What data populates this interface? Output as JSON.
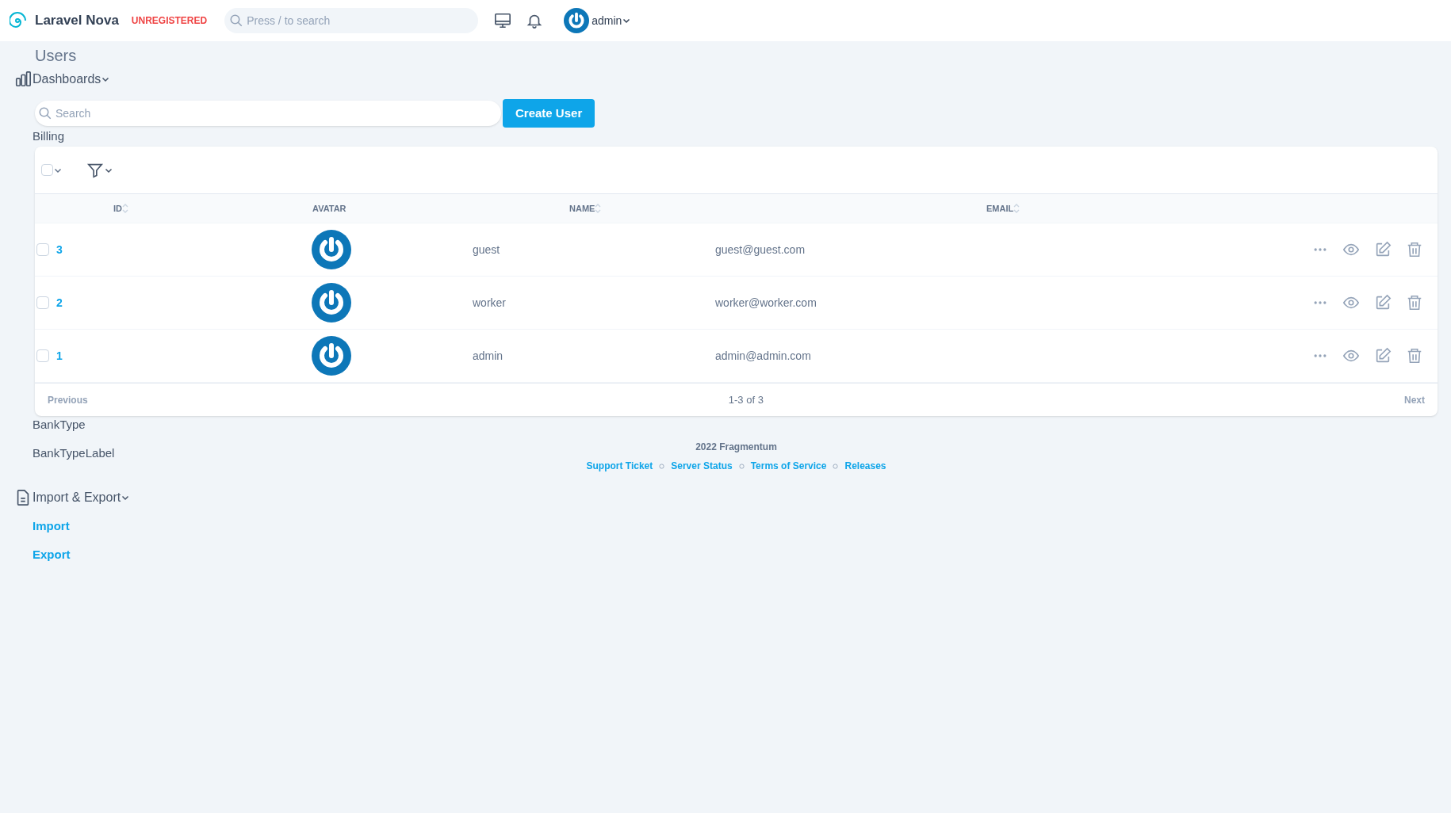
{
  "header": {
    "brand": "Laravel Nova",
    "badge": "UNREGISTERED",
    "search": {
      "placeholder": "Press / to search"
    },
    "user": "admin"
  },
  "sidebar": [
    {
      "kind": "group",
      "label": "Dashboards"
    },
    {
      "kind": "item",
      "label": "Billing"
    },
    {
      "kind": "item",
      "label": "BankType"
    },
    {
      "kind": "item",
      "label": "BankTypeLabel"
    },
    {
      "kind": "group",
      "label": "Import & Export"
    },
    {
      "kind": "link",
      "label": "Import"
    },
    {
      "kind": "link",
      "label": "Export"
    }
  ],
  "page": {
    "title": "Users",
    "search": {
      "placeholder": "Search"
    },
    "create_button": "Create User"
  },
  "table": {
    "columns": [
      "ID",
      "AVATAR",
      "NAME",
      "EMAIL"
    ],
    "rows": [
      {
        "id": "3",
        "name": "guest",
        "email": "guest@guest.com",
        "checked": false
      },
      {
        "id": "2",
        "name": "worker",
        "email": "worker@worker.com",
        "checked": false
      },
      {
        "id": "1",
        "name": "admin",
        "email": "admin@admin.com",
        "checked": false
      }
    ],
    "pagination": {
      "previous": "Previous",
      "range": "1-3 of 3",
      "next": "Next"
    }
  },
  "footer": {
    "copyright": "2022 Fragmentum",
    "links": [
      "Support Ticket",
      "Server Status",
      "Terms of Service",
      "Releases"
    ]
  }
}
